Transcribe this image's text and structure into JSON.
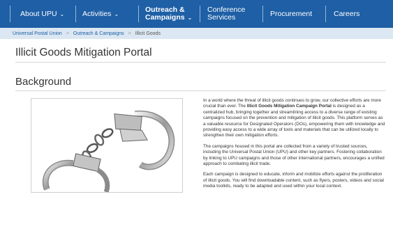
{
  "nav": {
    "items": [
      {
        "label": "About UPU",
        "has_chevron": true
      },
      {
        "label": "Activities",
        "has_chevron": true
      },
      {
        "label_line1": "Outreach &",
        "label_line2": "Campaigns",
        "has_chevron": true,
        "active": true
      },
      {
        "label_line1": "Conference",
        "label_line2": "Services",
        "has_chevron": false
      },
      {
        "label": "Procurement",
        "has_chevron": false
      },
      {
        "label": "Careers",
        "has_chevron": false
      }
    ],
    "chevron_glyph": "⌄"
  },
  "breadcrumb": {
    "items": [
      "Universal Postal Union",
      "Outreach & Campaigns",
      "Illicit Goods"
    ],
    "separator": ">"
  },
  "page_title": "Illicit Goods Mitigation Portal",
  "section_title": "Background",
  "image": {
    "subject": "handcuffs"
  },
  "body": {
    "p1_pre": "In a world where the threat of illicit goods continues to grow, our collective efforts are more crucial than ever. The ",
    "p1_bold": "Illicit Goods Mitigation Campaign Portal",
    "p1_post": " is designed as a centralized hub, bringing together and streamlining access to a diverse range of existing campaigns focused on the prevention and mitigation of illicit goods. This platform serves as a valuable resource for Designated Operators (DOs), empowering them with knowledge and providing easy access to a wide array of tools and materials that can be utilized locally to strengthen their own mitigation efforts.",
    "p2": "The campaigns housed in this portal are collected from a variety of trusted sources, including the Universal Postal Union (UPU) and other key partners. Fostering collaboration by linking to UPU campaigns and those of other international partners, encourages a unified approach to combating illicit trade.",
    "p3": "Each campaign is designed to educate, inform and mobilize efforts against the proliferation of illicit goods. You will find downloadable content, such as flyers, posters, videos and social media toolkits, ready to be adapted and used within your local context."
  },
  "colors": {
    "nav_bg": "#1e5fa5",
    "breadcrumb_bg": "#dbe7f2",
    "link": "#1e5fa5"
  }
}
